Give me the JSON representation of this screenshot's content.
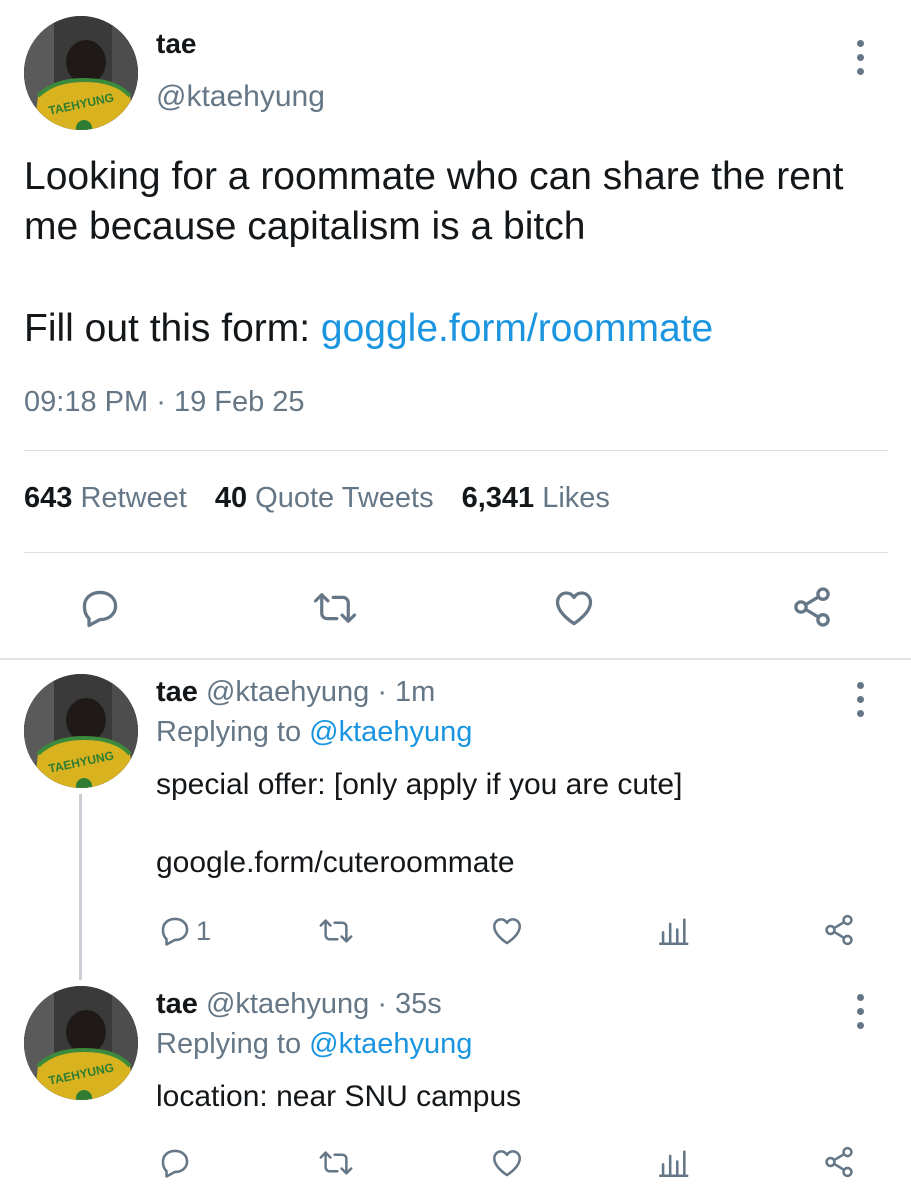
{
  "main_tweet": {
    "name": "tae",
    "handle": "@ktaehyung",
    "text": "Looking for a roommate who can share the rent me because capitalism is a bitch",
    "form_prefix": "Fill out this form: ",
    "form_link": "goggle.form/roommate",
    "time": "09:18 PM",
    "separator": "·",
    "date": "19 Feb 25",
    "stats": {
      "retweets_count": "643",
      "retweets_label": "Retweet",
      "quotes_count": "40",
      "quotes_label": "Quote Tweets",
      "likes_count": "6,341",
      "likes_label": "Likes"
    },
    "avatar_jersey_text": "TAEHYUNG"
  },
  "replies": [
    {
      "name": "tae",
      "handle": "@ktaehyung",
      "time": "· 1m",
      "replying_prefix": "Replying to ",
      "replying_to": "@ktaehyung",
      "text": "special offer: [only apply if you are cute]",
      "link": "google.form/cuteroommate",
      "reply_count": "1"
    },
    {
      "name": "tae",
      "handle": "@ktaehyung",
      "time": "· 35s",
      "replying_prefix": "Replying to ",
      "replying_to": "@ktaehyung",
      "text": "location: near SNU campus",
      "reply_count": ""
    }
  ],
  "colors": {
    "text": "#14171a",
    "secondary": "#657786",
    "link": "#1b95e0",
    "divider": "#dcdfe2"
  },
  "icons": [
    "reply-icon",
    "retweet-icon",
    "like-icon",
    "share-icon",
    "analytics-icon",
    "more-options-icon"
  ]
}
